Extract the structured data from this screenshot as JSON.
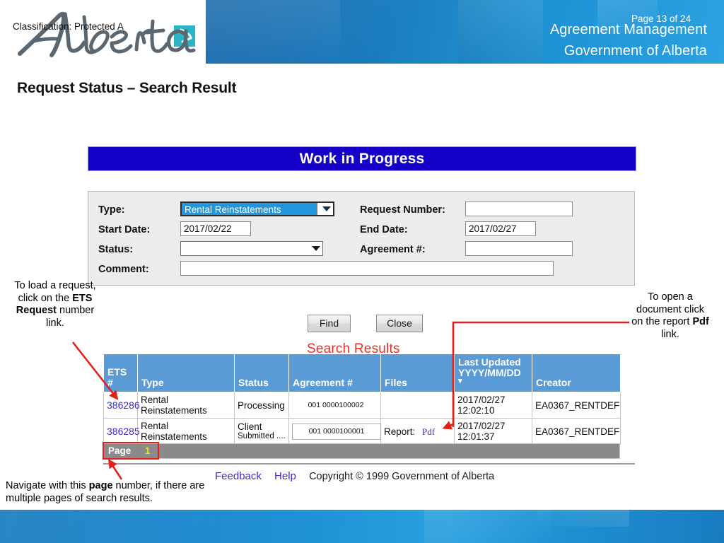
{
  "banner": {
    "logo_text": "Alberta",
    "title_line1": "Agreement Management",
    "title_line2": "Government of Alberta"
  },
  "slide": {
    "title": "Request Status – Search Result"
  },
  "app": {
    "header_bar": "Work in Progress",
    "form": {
      "type_label": "Type:",
      "type_value": "Rental Reinstatements",
      "request_number_label": "Request Number:",
      "request_number_value": "",
      "start_date_label": "Start Date:",
      "start_date_value": "2017/02/22",
      "end_date_label": "End Date:",
      "end_date_value": "2017/02/27",
      "status_label": "Status:",
      "status_value": "",
      "agreement_label": "Agreement #:",
      "agreement_value": "",
      "comment_label": "Comment:",
      "comment_value": ""
    },
    "buttons": {
      "find": "Find",
      "close": "Close"
    },
    "search_results_caption": "Search Results",
    "table": {
      "columns": [
        "ETS #",
        "Type",
        "Status",
        "Agreement #",
        "Files",
        "Last Updated\nYYYY/MM/DD",
        "Creator"
      ],
      "last_updated_header_line1": "Last Updated",
      "last_updated_header_line2": "YYYY/MM/DD",
      "sort_indicator": "▾",
      "rows": [
        {
          "ets": "386286",
          "type": "Rental Reinstatements",
          "status_main": "Processing",
          "status_sub": "",
          "agreement": "001 0000100002",
          "agreement_boxed": false,
          "files_label": "",
          "files_link": "",
          "updated_date": "2017/02/27",
          "updated_time": "12:02:10",
          "creator": "EA0367_RENTDEF"
        },
        {
          "ets": "386285",
          "type": "Rental Reinstatements",
          "status_main": "Client",
          "status_sub": "Submitted ....",
          "agreement": "001 0000100001",
          "agreement_boxed": true,
          "files_label": "Report:",
          "files_link": "Pdf",
          "updated_date": "2017/02/27",
          "updated_time": "12:01:37",
          "creator": "EA0367_RENTDEF"
        }
      ]
    },
    "pager": {
      "label": "Page",
      "value": "1"
    },
    "footer": {
      "feedback": "Feedback",
      "help": "Help",
      "copyright": "Copyright © 1999 Government of Alberta"
    }
  },
  "annotations": {
    "left": {
      "part1": "To load a request, click on the ",
      "bold1": "ETS Request",
      "part2": " number link."
    },
    "right": {
      "part1": "To open a document click on the report ",
      "bold1": "Pdf",
      "part2": " link."
    },
    "bottom": {
      "part1": "Navigate with this ",
      "bold1": "page",
      "part2": " number, if there are multiple pages of search results."
    }
  },
  "footer_bar": {
    "classification": "Classification: Protected A",
    "page_indicator": "Page 13 of 24"
  },
  "colors": {
    "banner_blue": "#1f8bcb",
    "wip_blue": "#1400c8",
    "table_header_blue": "#5b9bd5",
    "annotation_red": "#e32119",
    "link_purple": "#3b2ec4",
    "page_yellow": "#e8ec00"
  }
}
